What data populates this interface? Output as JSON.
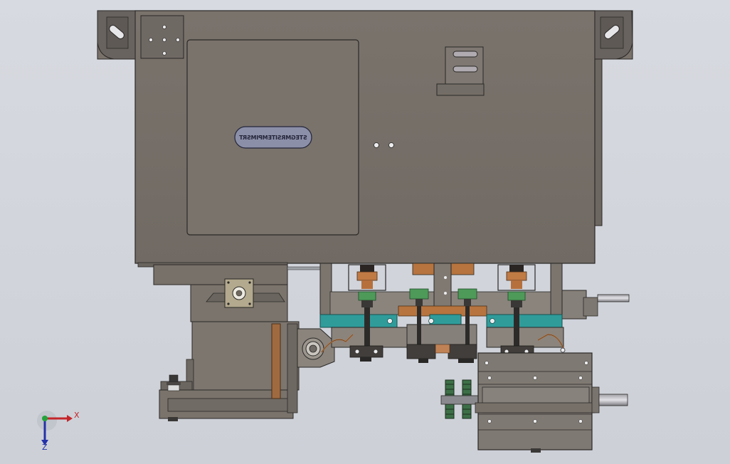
{
  "view": {
    "type": "cad-assembly-front-view",
    "colors": {
      "body": "#777069",
      "body_dark": "#5d5853",
      "outline": "#2a2826",
      "plate_blue": "#8c8fa8",
      "teal_rail": "#2f9c9a",
      "green_part": "#4e9a59",
      "copper": "#b8703c",
      "background": "#d2d5dc"
    }
  },
  "nameplate": {
    "text": "STEGMRSITEMPIMSRT"
  },
  "triad": {
    "x_label": "X",
    "z_label": "Z",
    "x_color": "#c4262b",
    "y_color": "#22a33b",
    "z_color": "#2431a8"
  }
}
